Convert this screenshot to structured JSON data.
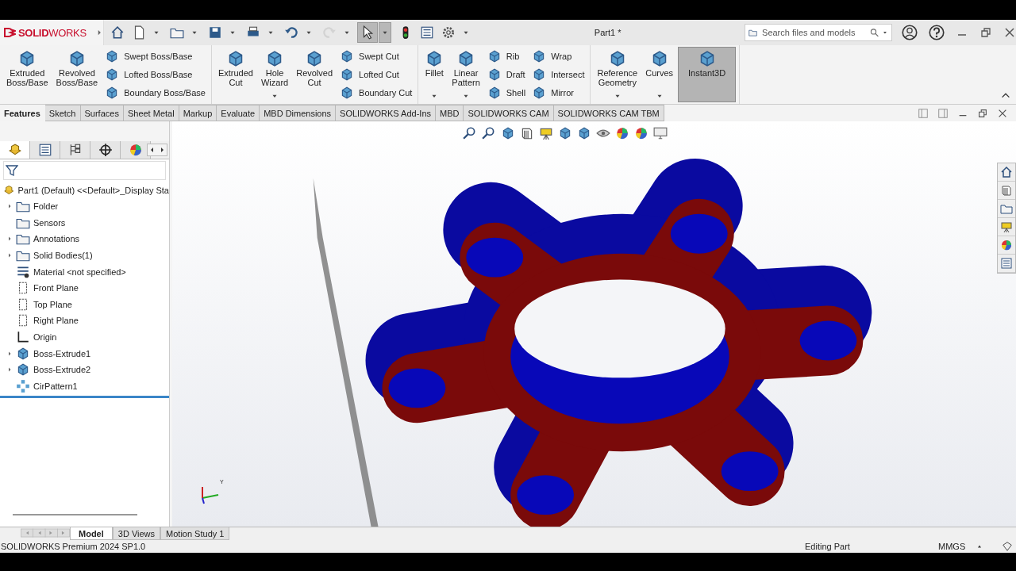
{
  "window": {
    "logo": "**SOLID**WORKS",
    "title": "Part1 *"
  },
  "quick_access": [
    {
      "selected": false,
      "disabled": false,
      "dropdown": false
    },
    {
      "selected": false,
      "disabled": false,
      "dropdown": true
    },
    {
      "selected": false,
      "disabled": false,
      "dropdown": true
    },
    {
      "selected": false,
      "disabled": false,
      "dropdown": true
    },
    {
      "selected": false,
      "disabled": false,
      "dropdown": true
    },
    {
      "selected": false,
      "disabled": false,
      "dropdown": true
    },
    {
      "selected": false,
      "disabled": true,
      "dropdown": true
    },
    {
      "selected": true,
      "disabled": false,
      "dropdown": true
    },
    {
      "selected": false,
      "disabled": false,
      "dropdown": false
    },
    {
      "selected": false,
      "disabled": false,
      "dropdown": false
    },
    {
      "selected": false,
      "disabled": false,
      "dropdown": true
    }
  ],
  "search": {
    "placeholder": "Search files and models"
  },
  "ribbon": {
    "groups": [
      {
        "items": [
          {
            "kind": "large",
            "label": "Extruded\nBoss/Base",
            "dropdown": false,
            "selected": false
          },
          {
            "kind": "large",
            "label": "Revolved\nBoss/Base",
            "dropdown": false,
            "selected": false
          },
          {
            "kind": "stack",
            "labels": [
              "Swept Boss/Base",
              "Lofted Boss/Base",
              "Boundary Boss/Base"
            ]
          }
        ]
      },
      {
        "items": [
          {
            "kind": "large",
            "label": "Extruded\nCut",
            "dropdown": false,
            "selected": false
          },
          {
            "kind": "large",
            "label": "Hole\nWizard",
            "dropdown": true,
            "selected": false
          },
          {
            "kind": "large",
            "label": "Revolved\nCut",
            "dropdown": false,
            "selected": false
          },
          {
            "kind": "stack",
            "labels": [
              "Swept Cut",
              "Lofted Cut",
              "Boundary Cut"
            ]
          }
        ]
      },
      {
        "items": [
          {
            "kind": "large",
            "label": "Fillet",
            "dropdown": true,
            "selected": false
          },
          {
            "kind": "large",
            "label": "Linear\nPattern",
            "dropdown": true,
            "selected": false
          },
          {
            "kind": "stack",
            "labels": [
              "Rib",
              "Draft",
              "Shell"
            ]
          },
          {
            "kind": "stack",
            "labels": [
              "Wrap",
              "Intersect",
              "Mirror"
            ]
          }
        ]
      },
      {
        "items": [
          {
            "kind": "large",
            "label": "Reference\nGeometry",
            "dropdown": true,
            "selected": false
          },
          {
            "kind": "large",
            "label": "Curves",
            "dropdown": true,
            "selected": false
          },
          {
            "kind": "large",
            "label": "Instant3D",
            "dropdown": false,
            "selected": true
          }
        ]
      }
    ]
  },
  "command_tabs": [
    {
      "label": "Features",
      "selected": true
    },
    {
      "label": "Sketch",
      "selected": false
    },
    {
      "label": "Surfaces",
      "selected": false
    },
    {
      "label": "Sheet Metal",
      "selected": false
    },
    {
      "label": "Markup",
      "selected": false
    },
    {
      "label": "Evaluate",
      "selected": false
    },
    {
      "label": "MBD Dimensions",
      "selected": false
    },
    {
      "label": "SOLIDWORKS Add-Ins",
      "selected": false
    },
    {
      "label": "MBD",
      "selected": false
    },
    {
      "label": "SOLIDWORKS CAM",
      "selected": false
    },
    {
      "label": "SOLIDWORKS CAM TBM",
      "selected": false
    }
  ],
  "panel_tabs": [
    {
      "selected": true
    },
    {
      "selected": false
    },
    {
      "selected": false
    },
    {
      "selected": false
    },
    {
      "selected": false
    }
  ],
  "tree": {
    "root": "Part1 (Default) <<Default>_Display Sta",
    "items": [
      {
        "kind": "folder",
        "label": "Folder",
        "has_children": true
      },
      {
        "kind": "sensors",
        "label": "Sensors",
        "has_children": false
      },
      {
        "kind": "annotations",
        "label": "Annotations",
        "has_children": true
      },
      {
        "kind": "bodies",
        "label": "Solid Bodies(1)",
        "has_children": true
      },
      {
        "kind": "material",
        "label": "Material <not specified>",
        "has_children": false
      },
      {
        "kind": "plane",
        "label": "Front Plane",
        "has_children": false
      },
      {
        "kind": "plane",
        "label": "Top Plane",
        "has_children": false
      },
      {
        "kind": "plane",
        "label": "Right Plane",
        "has_children": false
      },
      {
        "kind": "origin",
        "label": "Origin",
        "has_children": false
      },
      {
        "kind": "feature",
        "label": "Boss-Extrude1",
        "has_children": true
      },
      {
        "kind": "feature",
        "label": "Boss-Extrude2",
        "has_children": true
      },
      {
        "kind": "pattern",
        "label": "CirPattern1",
        "has_children": false
      }
    ]
  },
  "viewport": {
    "triad_label": "Y"
  },
  "bottom_tabs": [
    {
      "label": "Model",
      "selected": true
    },
    {
      "label": "3D Views",
      "selected": false
    },
    {
      "label": "Motion Study 1",
      "selected": false
    }
  ],
  "status_bar": {
    "product": "SOLIDWORKS Premium 2024 SP1.0",
    "mode": "Editing Part",
    "units": "MMGS"
  }
}
